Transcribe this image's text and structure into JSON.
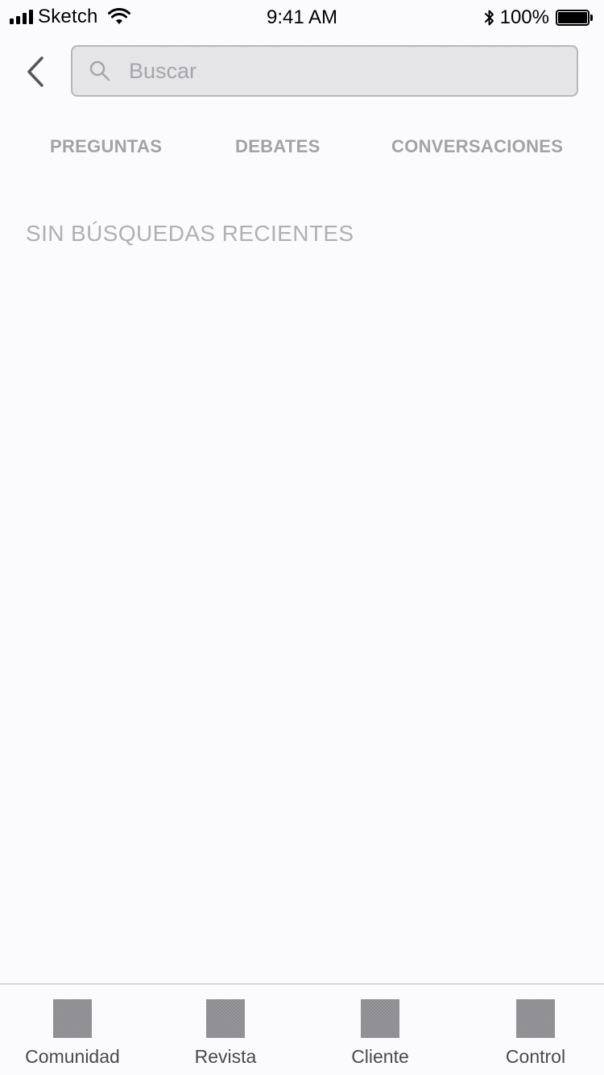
{
  "status_bar": {
    "carrier": "Sketch",
    "time": "9:41 AM",
    "battery_percent": "100%",
    "battery_level": 1.0,
    "icons": [
      "signal-icon",
      "wifi-icon",
      "bluetooth-icon",
      "battery-icon"
    ]
  },
  "header": {
    "back_icon": "chevron-left-icon",
    "search": {
      "icon": "search-icon",
      "placeholder": "Buscar",
      "value": ""
    }
  },
  "tabs": [
    {
      "label": "PREGUNTAS"
    },
    {
      "label": "DEBATES"
    },
    {
      "label": "CONVERSACIONES"
    }
  ],
  "main": {
    "empty_message": "SIN BÚSQUEDAS RECIENTES"
  },
  "tab_bar": {
    "items": [
      {
        "label": "Comunidad",
        "icon": "placeholder-square-icon"
      },
      {
        "label": "Revista",
        "icon": "placeholder-square-icon"
      },
      {
        "label": "Cliente",
        "icon": "placeholder-square-icon"
      },
      {
        "label": "Control",
        "icon": "placeholder-square-icon"
      }
    ]
  },
  "colors": {
    "background": "#fbfbfd",
    "search_fill": "#e3e3e6",
    "tab_text": "#a3a3a6",
    "empty_text": "#b0b0b3",
    "tab_bar_icon": "#8b8b8f",
    "tab_bar_label": "#4a4a4d"
  }
}
